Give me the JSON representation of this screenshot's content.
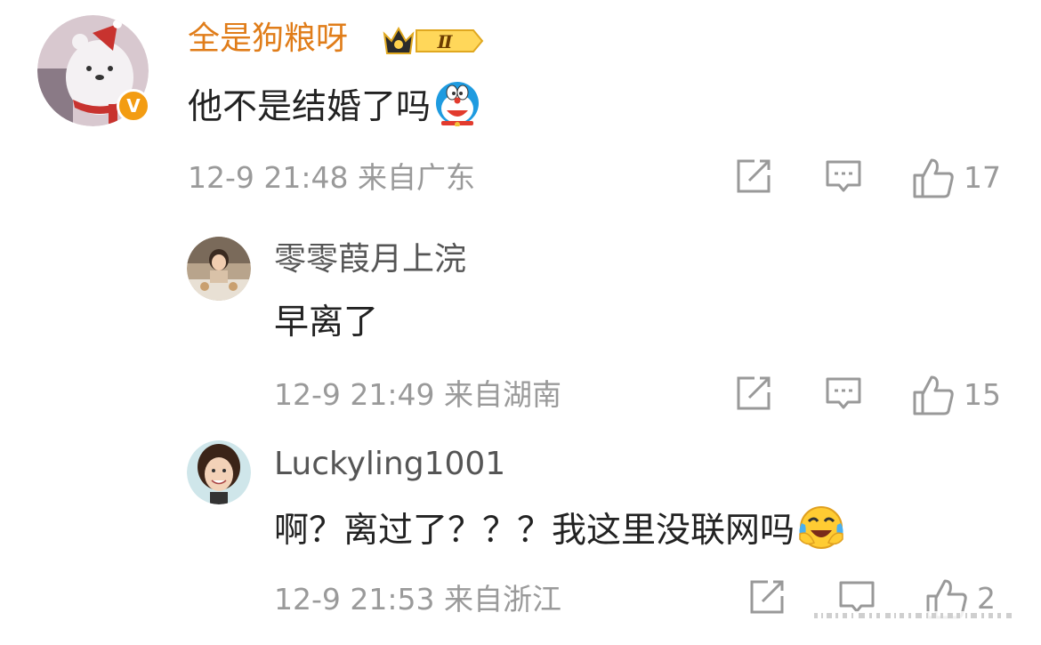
{
  "comments": [
    {
      "username": "全是狗粮呀",
      "badge_level": "Ⅱ",
      "verified_badge": "V",
      "text": "他不是结婚了吗",
      "emoji": "doraemon-emoji",
      "meta": "12-9 21:48 来自广东",
      "likes": "17"
    },
    {
      "username": "零零葭月上浣",
      "text": "早离了",
      "meta": "12-9 21:49 来自湖南",
      "likes": "15"
    },
    {
      "username": "Luckyling1001",
      "text": "啊？离过了？？？我这里没联网吗",
      "emoji": "laugh-cry-emoji",
      "meta": "12-9 21:53 来自浙江",
      "likes": "2"
    }
  ],
  "colors": {
    "username_accent": "#e07d1a",
    "meta_gray": "#9a9a9a",
    "verified_orange": "#f39c12"
  },
  "icons": [
    "share-icon",
    "comment-icon",
    "like-icon"
  ]
}
